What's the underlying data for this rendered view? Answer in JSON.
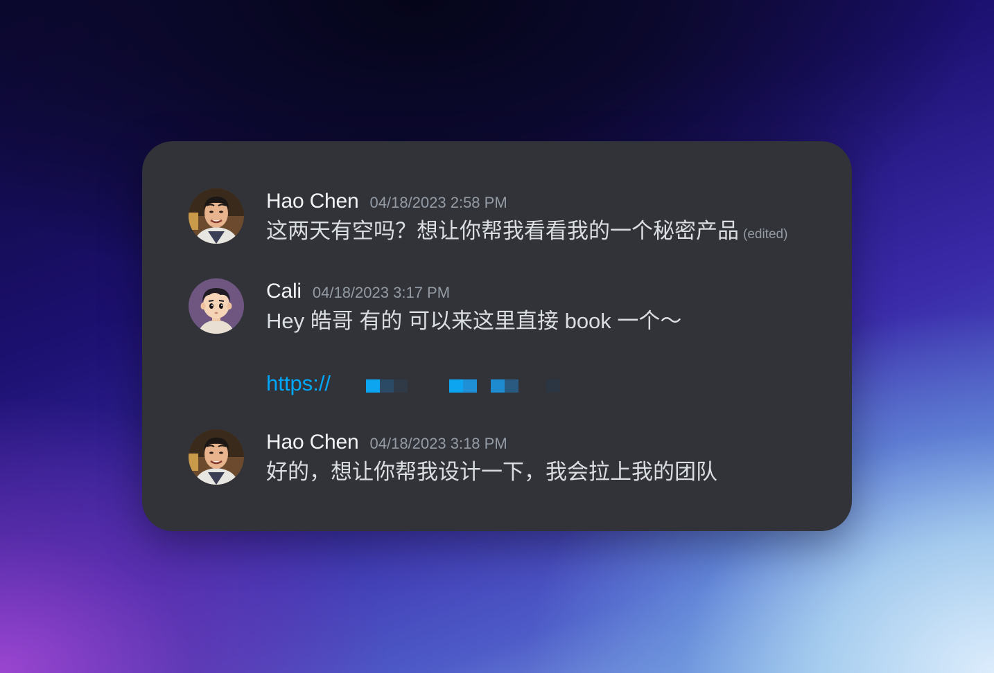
{
  "messages": [
    {
      "author": "Hao Chen",
      "timestamp": "04/18/2023 2:58 PM",
      "text": "这两天有空吗？想让你帮我看看我的一个秘密产品",
      "edited": "(edited)",
      "avatar": "man-avatar"
    },
    {
      "author": "Cali",
      "timestamp": "04/18/2023 3:17 PM",
      "text": "Hey 皓哥 有的 可以来这里直接 book 一个～",
      "link": "https://",
      "avatar": "cartoon-boy-avatar"
    },
    {
      "author": "Hao Chen",
      "timestamp": "04/18/2023 3:18 PM",
      "text": "好的，想让你帮我设计一下，我会拉上我的团队",
      "avatar": "man-avatar"
    }
  ],
  "colors": {
    "card_bg": "#313338",
    "link": "#00a8fc",
    "name": "#f2f3f5",
    "timestamp": "#949ba4",
    "text": "#dbdee1"
  }
}
